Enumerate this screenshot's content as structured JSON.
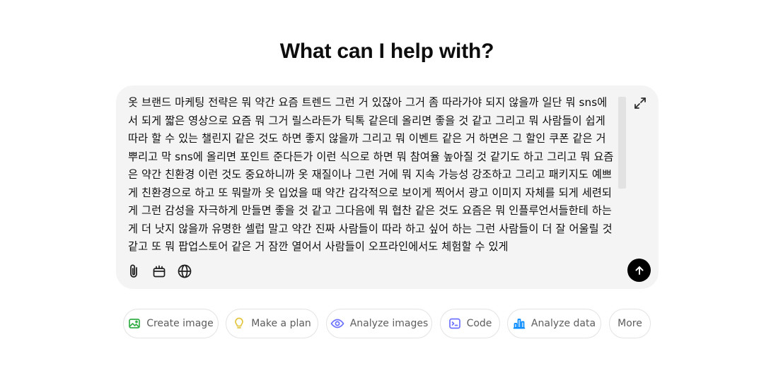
{
  "heading": "What can I help with?",
  "composer": {
    "prompt_text": "옷 브랜드 마케팅 전략은 뭐 약간 요즘 트렌드 그런 거 있잖아 그거 좀 따라가야 되지 않을까 일단 뭐 sns에서 되게 짧은 영상으로 요즘 뭐 그거 릴스라든가 틱톡 같은데 올리면 좋을 것 같고 그리고 뭐 사람들이 쉽게 따라 할 수 있는 챌린지 같은 것도 하면 좋지 않을까 그리고 뭐 이벤트 같은 거 하면은 그 할인 쿠폰 같은 거 뿌리고 막 sns에 올리면 포인트 준다든가 이런 식으로 하면 뭐 참여율 높아질 것 같기도 하고 그리고 뭐 요즘은 약간 친환경 이런 것도 중요하니까 옷 재질이나 그런 거에 뭐 지속 가능성 강조하고 그리고 패키지도 예쁘게 친환경으로 하고 또 뭐랄까 옷 입었을 때 약간 감각적으로 보이게 찍어서 광고 이미지 자체를 되게 세련되게 그런 감성을 자극하게 만들면 좋을 것 같고 그다음에 뭐 협찬 같은 것도 요즘은 뭐 인플루언서들한테 하는 게 더 낫지 않을까 유명한 셀럽 말고 약간 진짜 사람들이 따라 하고 싶어 하는 그런 사람들이 더 잘 어울릴 것 같고 또 뭐 팝업스토어 같은 거 잠깐 열어서 사람들이 오프라인에서도 체험할 수 있게",
    "icons": {
      "expand": "expand-icon",
      "attach": "paperclip-icon",
      "tools": "tools-icon",
      "web": "globe-icon",
      "send": "arrow-up-icon"
    }
  },
  "suggestions": [
    {
      "label": "Create image",
      "icon": "image-icon",
      "color": "#35ae47"
    },
    {
      "label": "Make a plan",
      "icon": "lightbulb-icon",
      "color": "#e2c541"
    },
    {
      "label": "Analyze images",
      "icon": "eye-icon",
      "color": "#6c71ff"
    },
    {
      "label": "Code",
      "icon": "code-icon",
      "color": "#6c71ff"
    },
    {
      "label": "Analyze data",
      "icon": "bar-chart-icon",
      "color": "#0088ff"
    },
    {
      "label": "More",
      "icon": "",
      "color": "#5d5d5d"
    }
  ]
}
